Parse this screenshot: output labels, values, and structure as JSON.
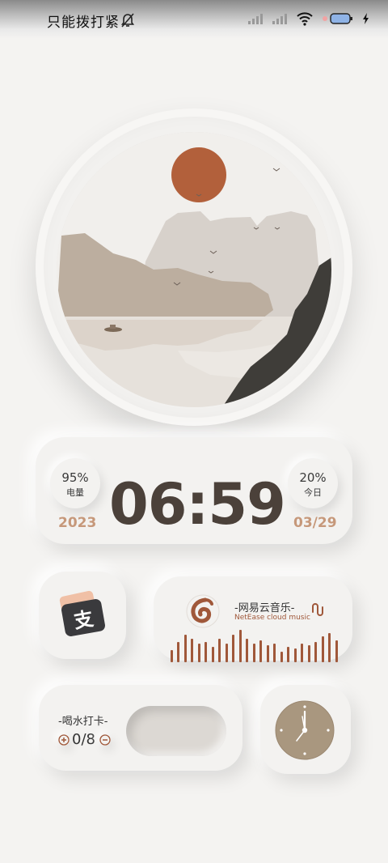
{
  "status": {
    "carrier": "只能拨打紧",
    "carrier_suffix": "",
    "icons": [
      "mute-bell-icon",
      "signal-icon",
      "signal-icon",
      "wifi-icon",
      "battery-icon",
      "charging-icon"
    ]
  },
  "clock": {
    "battery_percent": "95%",
    "battery_label": "电量",
    "today_percent": "20%",
    "today_label": "今日",
    "time": "06:59",
    "year": "2023",
    "date": "03/29"
  },
  "alipay": {
    "label": "支"
  },
  "music": {
    "title": "-网易云音乐-",
    "subtitle": "NetEase cloud music",
    "bars": [
      0.35,
      0.6,
      0.8,
      0.7,
      0.55,
      0.6,
      0.45,
      0.7,
      0.55,
      0.8,
      0.95,
      0.7,
      0.55,
      0.65,
      0.5,
      0.55,
      0.3,
      0.45,
      0.4,
      0.55,
      0.5,
      0.6,
      0.75,
      0.85,
      0.65
    ],
    "accent": "#a0583a"
  },
  "water": {
    "title": "-喝水打卡-",
    "count": "0/8"
  },
  "colors": {
    "sun": "#b2603b",
    "time": "#4b413a",
    "accent_brown": "#c6987a"
  }
}
